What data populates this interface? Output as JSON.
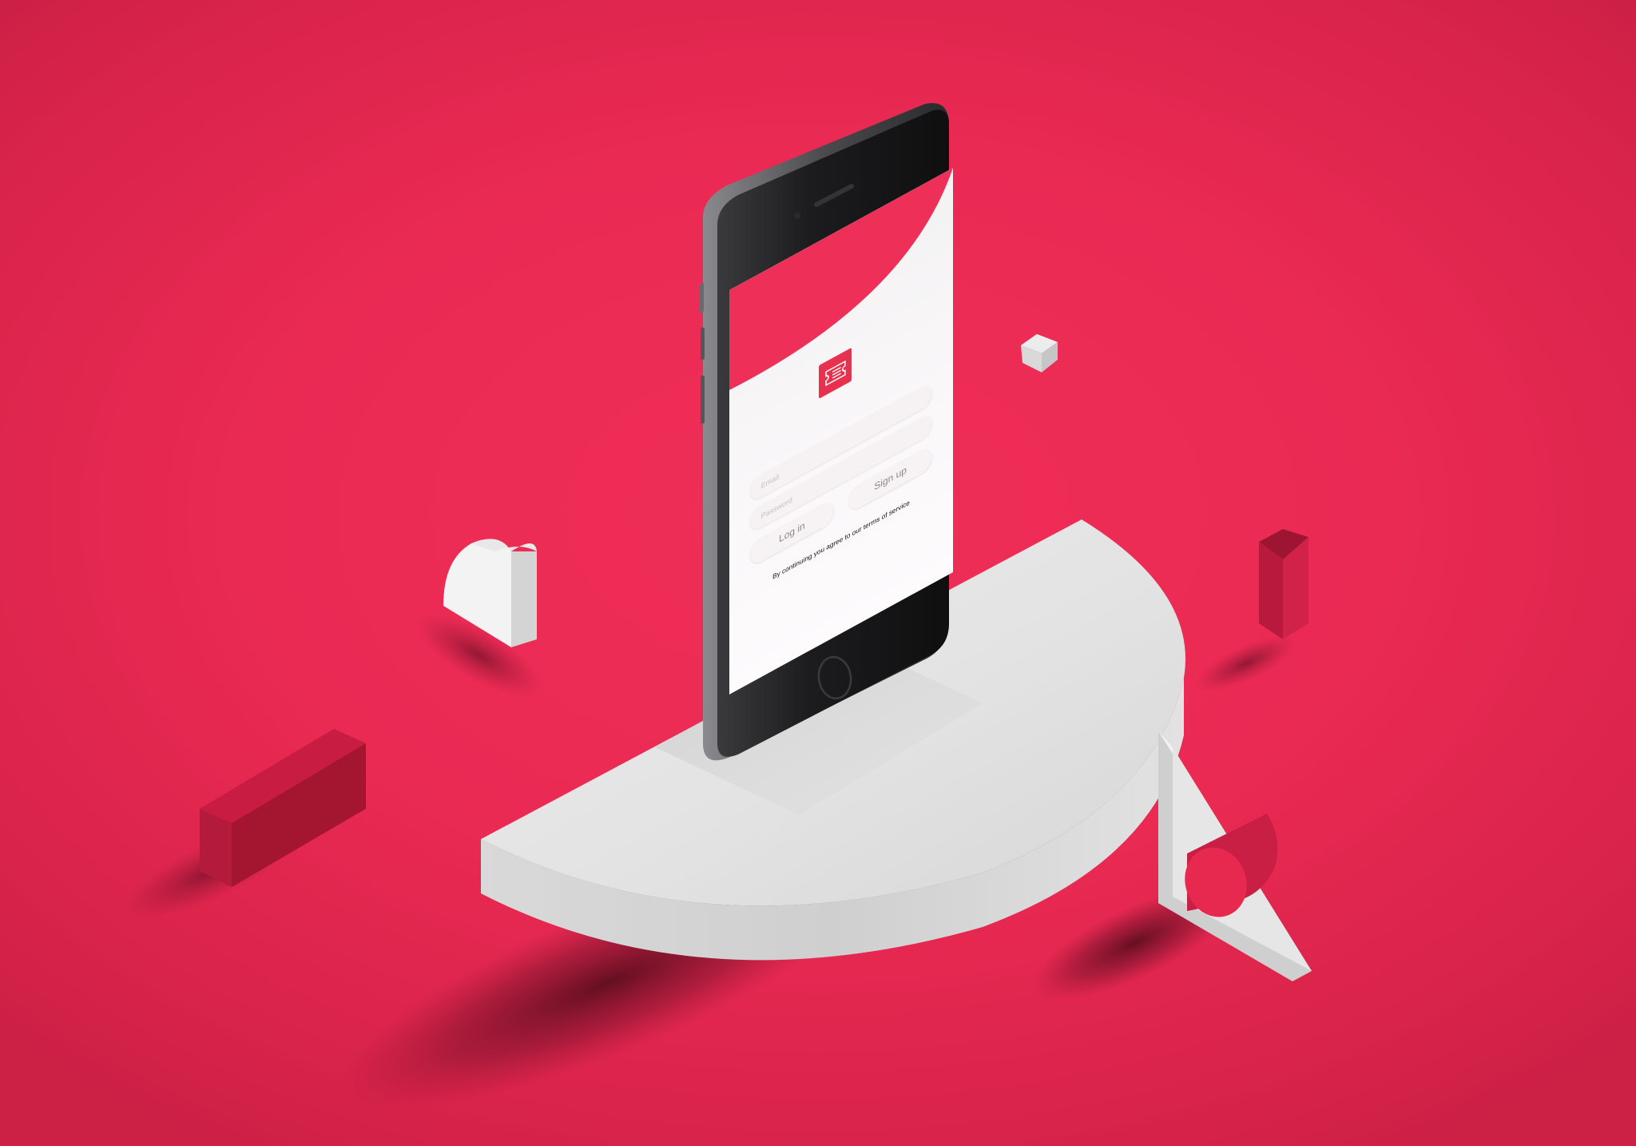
{
  "app": {
    "brand_color": "#e8304f",
    "logo_icon": "ticket-icon"
  },
  "login": {
    "email_placeholder": "Email",
    "password_placeholder": "Password",
    "login_label": "Log in",
    "signup_label": "Sign up",
    "terms_text": "By continuing you agree to our terms of service"
  },
  "scene": {
    "background_color": "#ec2b55",
    "pedestal_color": "#e8e8e8"
  }
}
